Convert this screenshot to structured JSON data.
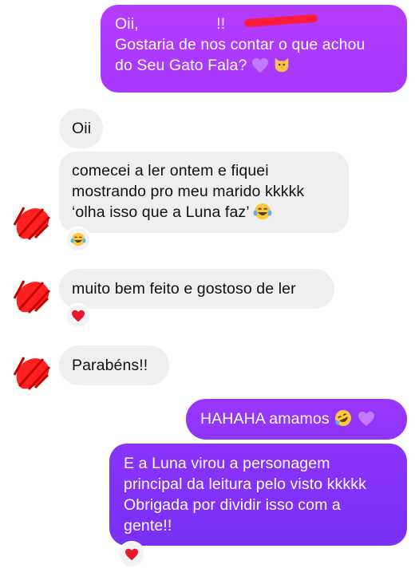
{
  "colors": {
    "outgoing_gradient_top": "#b43cff",
    "outgoing_gradient_bottom": "#7b31f5",
    "incoming_bubble": "#efeff1",
    "incoming_text": "#111111",
    "redaction": "#ff1c3a"
  },
  "messages": [
    {
      "direction": "outgoing",
      "lines": [
        "Oii, ",
        "Gostaria de nos contar o que achou",
        "do Seu Gato Fala?"
      ],
      "emoji": [
        "purple-heart-icon",
        "cat-face-icon"
      ]
    },
    {
      "direction": "incoming",
      "lines": [
        "Oii"
      ]
    },
    {
      "direction": "incoming",
      "lines": [
        "comecei a ler ontem e fiquei",
        "mostrando pro meu marido kkkkk",
        "‘olha isso que a Luna faz’"
      ],
      "emoji": [
        "tears-of-joy-icon"
      ],
      "reaction": "tears-of-joy-icon"
    },
    {
      "direction": "incoming",
      "lines": [
        "muito bem feito e gostoso de ler"
      ],
      "reaction": "red-heart-icon"
    },
    {
      "direction": "incoming",
      "lines": [
        "Parabéns!!"
      ]
    },
    {
      "direction": "outgoing",
      "lines": [
        "HAHAHA amamos"
      ],
      "emoji": [
        "rolling-laughing-icon",
        "purple-heart-icon"
      ]
    },
    {
      "direction": "outgoing",
      "lines": [
        "E a Luna virou a personagem",
        "principal da leitura pelo visto kkkkk",
        "Obrigada por dividir isso com a",
        "gente!!"
      ],
      "reaction": "red-heart-icon"
    }
  ]
}
